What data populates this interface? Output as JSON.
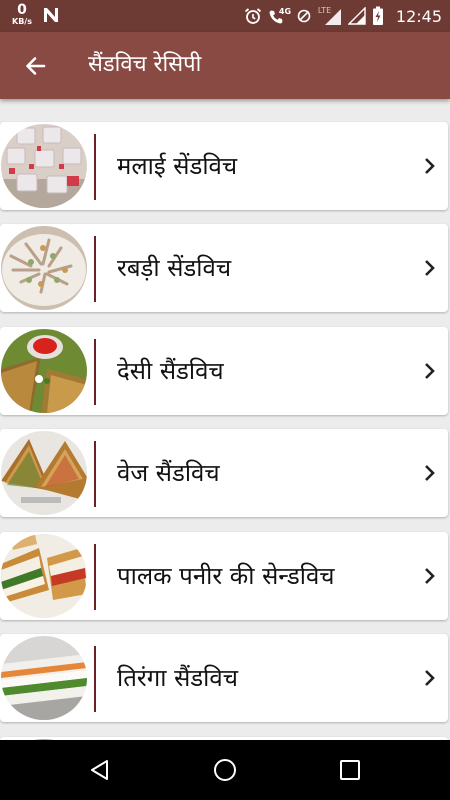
{
  "status_bar": {
    "net_speed_value": "0",
    "net_speed_unit": "KB/s",
    "network_label": "4G",
    "lte_label": "LTE",
    "time": "12:45"
  },
  "app_bar": {
    "title": "सैंडविच रेसिपी",
    "back_icon": "arrow-left-icon"
  },
  "recipes": [
    {
      "label": "मलाई सेंडविच"
    },
    {
      "label": "रबड़ी सेंडविच"
    },
    {
      "label": "देसी सैंडविच"
    },
    {
      "label": "वेज सैंडविच"
    },
    {
      "label": "पालक पनीर की सेन्डविच"
    },
    {
      "label": "तिरंगा सैंडविच"
    }
  ],
  "nav_bar": {
    "back_icon": "triangle-back-icon",
    "home_icon": "circle-home-icon",
    "recents_icon": "square-recents-icon"
  },
  "colors": {
    "status_bar": "#6e3a34",
    "app_bar": "#8a4a44",
    "divider": "#6b2226",
    "background": "#ececec"
  }
}
